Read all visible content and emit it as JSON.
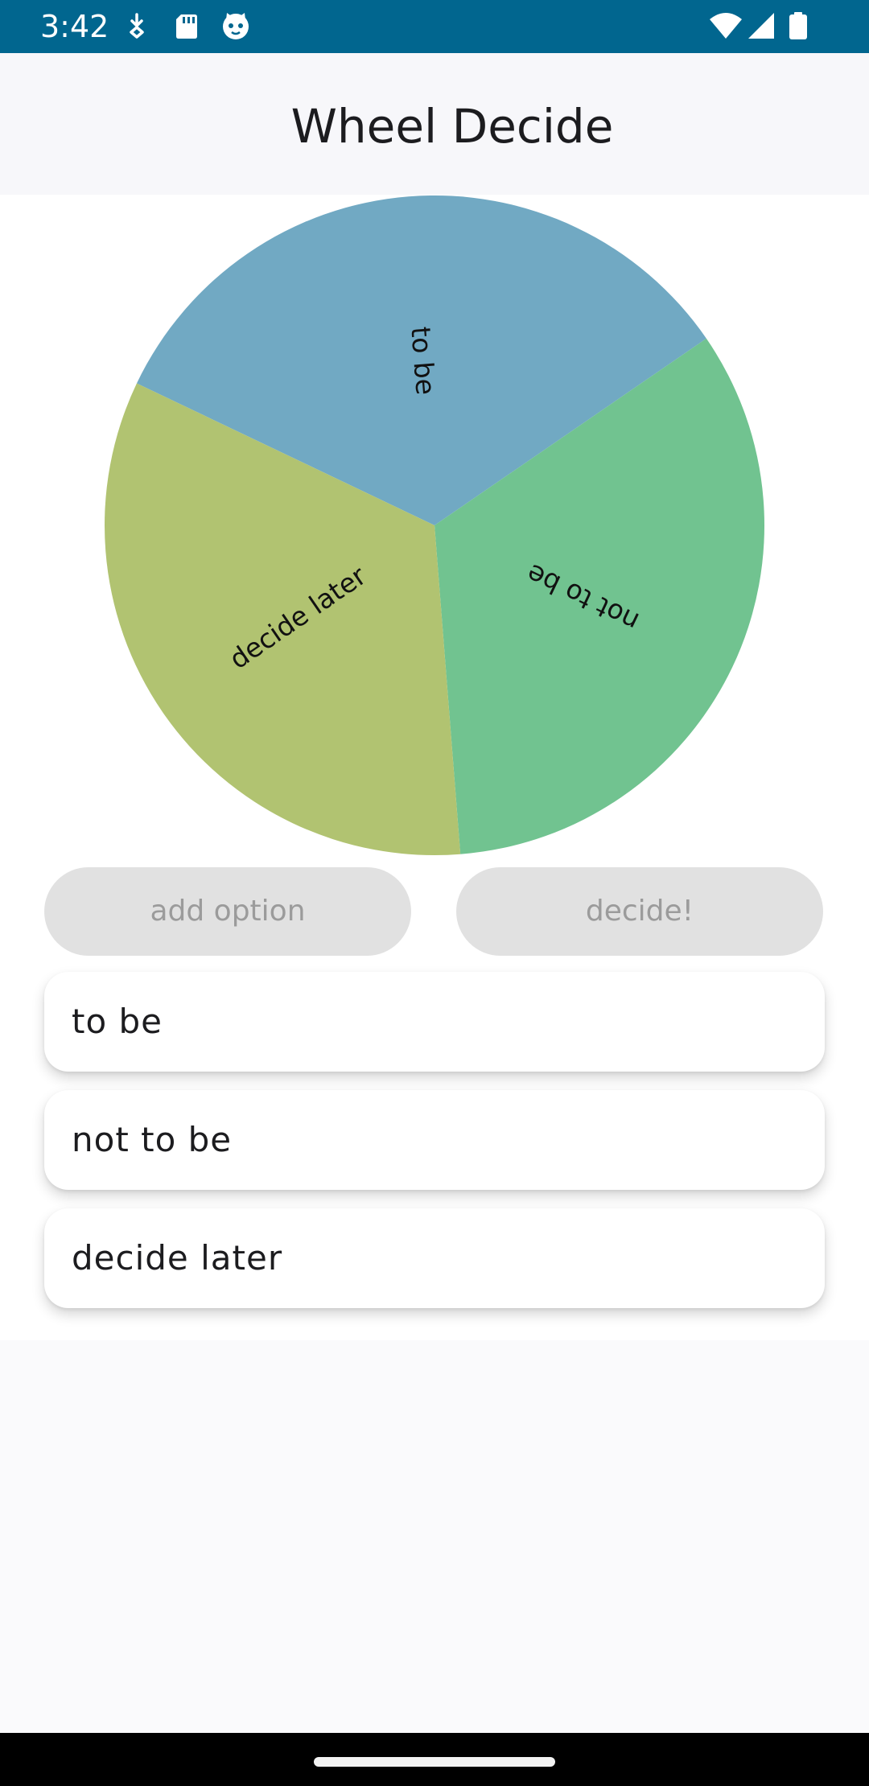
{
  "status_bar": {
    "time": "3:42",
    "background": "#01668f",
    "left_icons": [
      "download-icon",
      "sd-card-icon",
      "cat-face-icon"
    ],
    "right_icons": [
      "wifi-icon",
      "signal-icon",
      "battery-icon"
    ]
  },
  "app_bar": {
    "title": "Wheel Decide"
  },
  "wheel": {
    "segments": [
      {
        "label": "to be",
        "color": "#71a9c3"
      },
      {
        "label": "not to be",
        "color": "#71c390"
      },
      {
        "label": "decide later",
        "color": "#b1c371"
      }
    ]
  },
  "buttons": {
    "add_option": "add option",
    "decide": "decide!"
  },
  "options": [
    {
      "label": "to be"
    },
    {
      "label": "not to be"
    },
    {
      "label": "decide later"
    }
  ]
}
